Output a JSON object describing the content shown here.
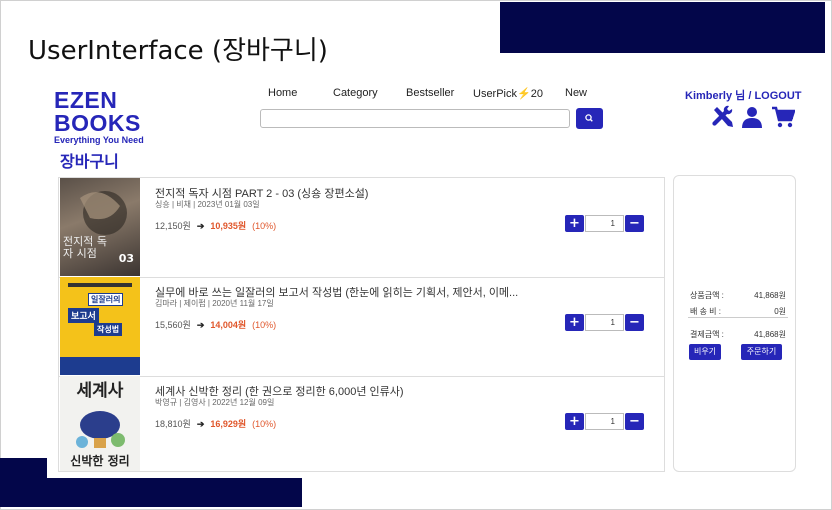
{
  "slide": {
    "title": "UserInterface (장바구니)"
  },
  "logo": {
    "line1": "EZEN",
    "line2": "BOOKS",
    "tagline": "Everything You Need"
  },
  "nav": {
    "home": "Home",
    "category": "Category",
    "bestseller": "Bestseller",
    "userpick": "UserPick⚡20",
    "new": "New"
  },
  "user": {
    "greeting": "Kimberly 님",
    "separator": "/",
    "logout": "LOGOUT"
  },
  "search": {
    "placeholder": ""
  },
  "header_icons": [
    "tools-icon",
    "user-icon",
    "cart-icon"
  ],
  "page": {
    "heading": "장바구니"
  },
  "cart": {
    "items": [
      {
        "title": "전지적 독자 시점 PART 2 - 03 (싱숑 장편소설)",
        "meta": "싱숑 | 비채 | 2023년 01월 03일",
        "price": "12,150원",
        "sale": "10,935원",
        "rate": "(10%)",
        "qty": "1",
        "cover_text": "전지적 독자 시점",
        "cover_num": "03"
      },
      {
        "title": "실무에 바로 쓰는 일잘러의 보고서 작성법 (한눈에 읽히는 기획서, 제안서, 이메...",
        "meta": "김마라 | 제이펍 | 2020년 11월 17일",
        "price": "15,560원",
        "sale": "14,004원",
        "rate": "(10%)",
        "qty": "1",
        "cover_lines": [
          "일잘러의",
          "보고서",
          "작성법"
        ]
      },
      {
        "title": "세계사 신박한 정리 (한 권으로 정리한 6,000년 인류사)",
        "meta": "박영규 | 김영사 | 2022년 12월 09일",
        "price": "18,810원",
        "sale": "16,929원",
        "rate": "(10%)",
        "qty": "1",
        "cover_top": "세계사",
        "cover_bottom": "신박한 정리"
      }
    ]
  },
  "summary": {
    "product_label": "상품금액 :",
    "product_value": "41,868원",
    "shipping_label": "배 송 비 :",
    "shipping_value": "0원",
    "total_label": "결제금액 :",
    "total_value": "41,868원",
    "clear_button": "비우기",
    "order_button": "주문하기"
  },
  "colors": {
    "navy": "#03064a",
    "brand": "#2626b8",
    "sale": "#e0572c"
  }
}
